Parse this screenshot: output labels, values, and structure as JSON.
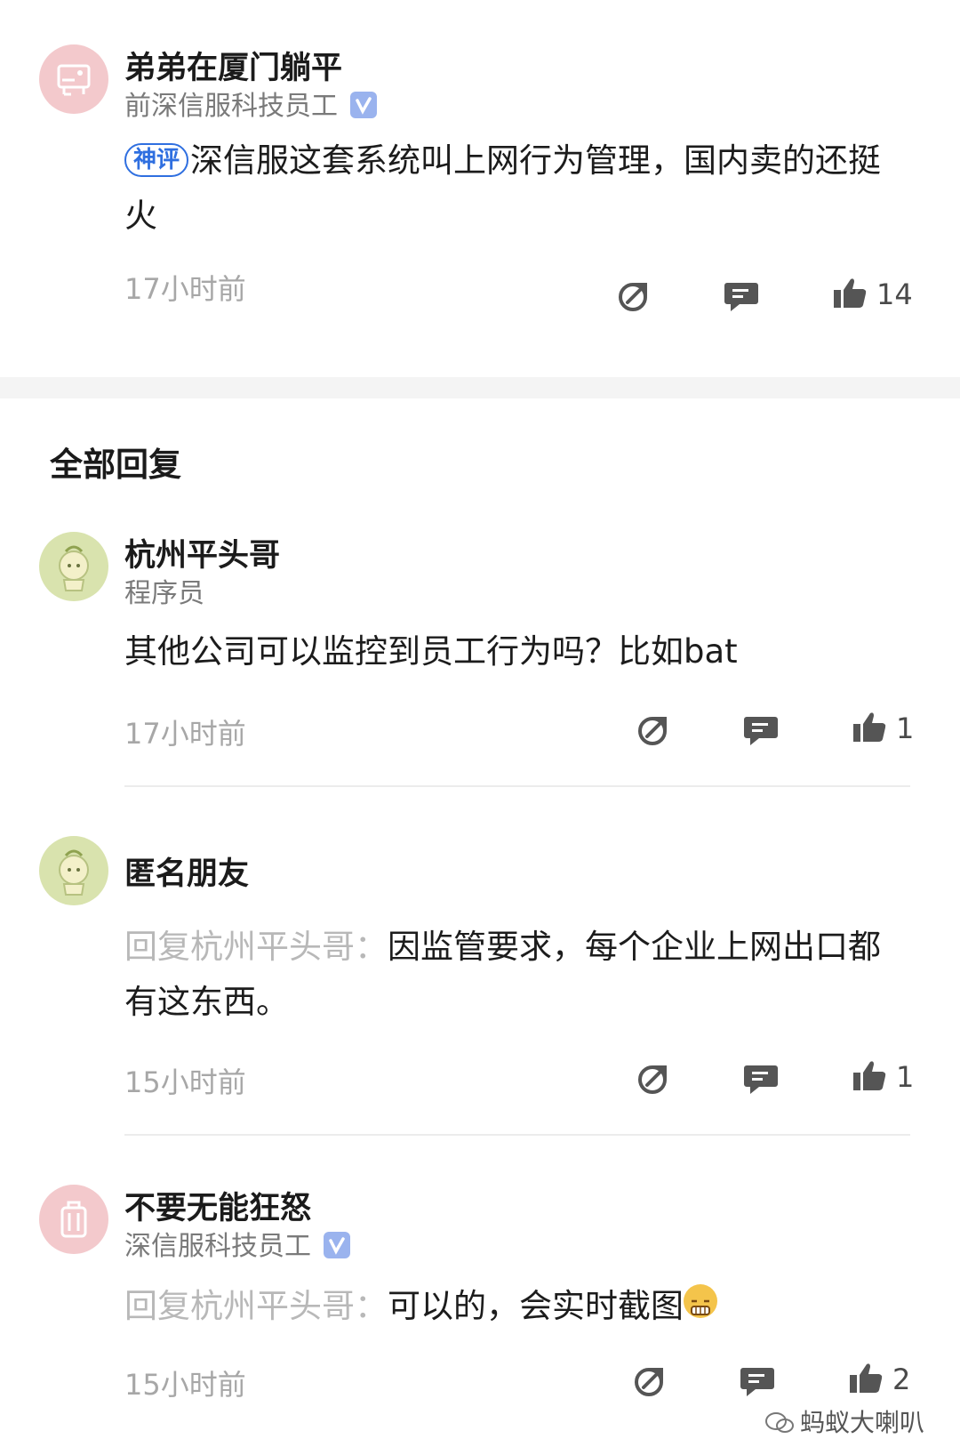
{
  "top_comment": {
    "user": "弟弟在厦门躺平",
    "title": "前深信服科技员工",
    "verified": true,
    "badge": "神评",
    "text": "深信服这套系统叫上网行为管理，国内卖的还挺火",
    "time": "17小时前",
    "likes": "14"
  },
  "section_title": "全部回复",
  "replies": [
    {
      "user": "杭州平头哥",
      "title": "程序员",
      "text": "其他公司可以监控到员工行为吗？比如bat",
      "time": "17小时前",
      "likes": "1"
    },
    {
      "user": "匿名朋友",
      "reply_prefix": "回复杭州平头哥：",
      "text": "因监管要求，每个企业上网出口都有这东西。",
      "time": "15小时前",
      "likes": "1"
    },
    {
      "user": "不要无能狂怒",
      "title": "深信服科技员工",
      "verified": true,
      "reply_prefix": "回复杭州平头哥：",
      "text": "可以的，会实时截图",
      "time": "15小时前",
      "likes": "2"
    }
  ],
  "icons": {
    "share": "share-icon",
    "comment": "comment-icon",
    "like": "thumbs-up-icon",
    "verified": "verified-v-icon"
  },
  "colors": {
    "badge_blue": "#2f6fe0",
    "verified_blue": "#9ab3ee",
    "icon_gray": "#555555"
  },
  "watermark": "蚂蚁大喇叭"
}
